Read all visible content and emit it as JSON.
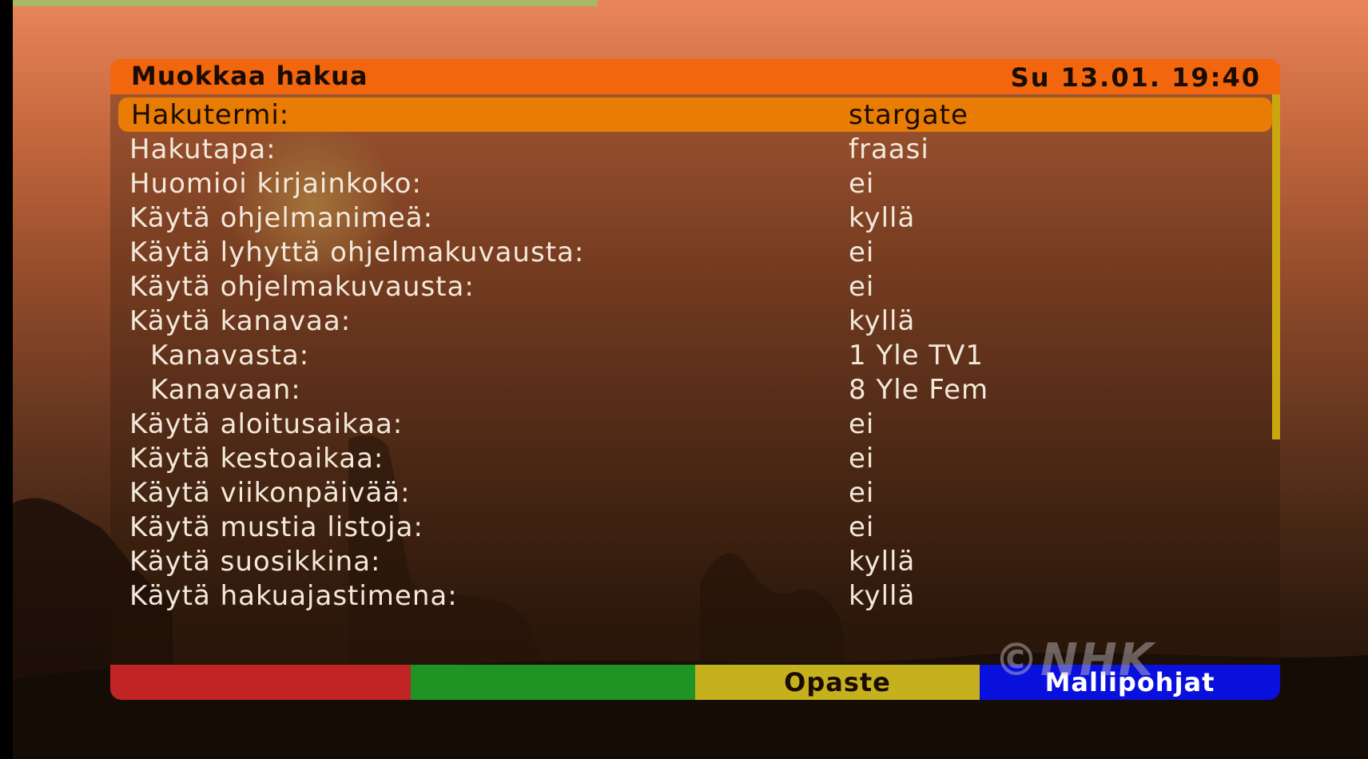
{
  "header": {
    "title": "Muokkaa hakua",
    "datetime": "Su  13.01. 19:40"
  },
  "rows": [
    {
      "label": "Hakutermi:",
      "value": "stargate"
    },
    {
      "label": "Hakutapa:",
      "value": "fraasi"
    },
    {
      "label": "Huomioi kirjainkoko:",
      "value": "ei"
    },
    {
      "label": "Käytä ohjelmanimeä:",
      "value": "kyllä"
    },
    {
      "label": "Käytä lyhyttä ohjelmakuvausta:",
      "value": "ei"
    },
    {
      "label": "Käytä ohjelmakuvausta:",
      "value": "ei"
    },
    {
      "label": "Käytä kanavaa:",
      "value": "kyllä"
    },
    {
      "label": "Kanavasta:",
      "value": "1 Yle TV1"
    },
    {
      "label": "Kanavaan:",
      "value": "8 Yle Fem"
    },
    {
      "label": "Käytä aloitusaikaa:",
      "value": "ei"
    },
    {
      "label": "Käytä kestoaikaa:",
      "value": "ei"
    },
    {
      "label": "Käytä viikonpäivää:",
      "value": "ei"
    },
    {
      "label": "Käytä mustia listoja:",
      "value": "ei"
    },
    {
      "label": "Käytä suosikkina:",
      "value": "kyllä"
    },
    {
      "label": "Käytä hakuajastimena:",
      "value": "kyllä"
    }
  ],
  "selected_row": "Hakutermi:",
  "buttons": {
    "red": "",
    "green": "",
    "yellow": "Opaste",
    "blue": "Mallipohjat"
  },
  "watermark": "©NHK",
  "colors": {
    "header": "#f2660d",
    "selected": "#e87c05",
    "red": "#c02424",
    "green": "#1f9323",
    "yellow": "#c5b01d",
    "blue": "#0a10dc"
  }
}
